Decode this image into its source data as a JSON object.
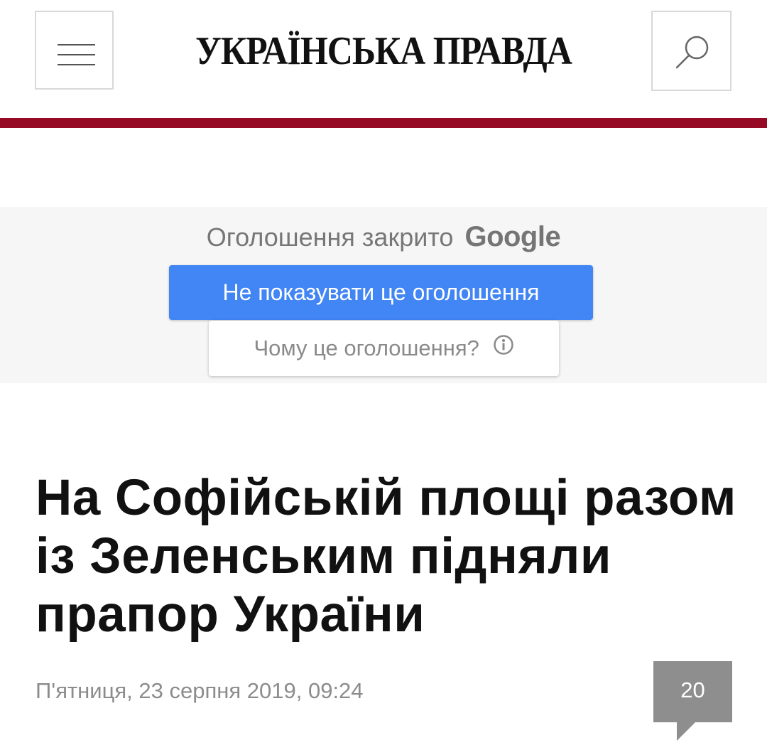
{
  "header": {
    "menu_icon": "hamburger-menu-icon",
    "logo_text": "УКРАЇНСЬКА ПРАВДА",
    "search_icon": "magnifier-icon",
    "accent_color": "#960a26"
  },
  "ad": {
    "closed_text": "Оголошення закрито",
    "brand": "Google",
    "hide_button_label": "Не показувати це оголошення",
    "why_button_label": "Чому це оголошення?",
    "why_icon": "info-icon",
    "button_color": "#4285f4"
  },
  "article": {
    "headline": "На Софійській площі разом із Зеленським підняли прапор України",
    "date": "П'ятниця, 23 серпня 2019, 09:24",
    "comments_count": "20"
  }
}
